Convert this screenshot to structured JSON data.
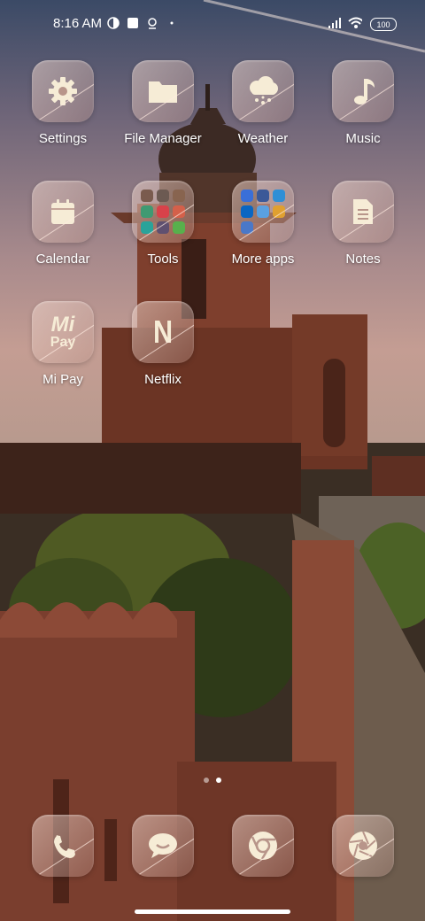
{
  "status_bar": {
    "time": "8:16 AM",
    "battery": "100",
    "icons": [
      "vpn-icon",
      "notification-square-icon",
      "location-pin-icon",
      "dot-icon",
      "signal-icon",
      "wifi-icon",
      "battery-icon"
    ]
  },
  "apps": [
    {
      "label": "Settings",
      "icon": "gear-icon"
    },
    {
      "label": "File Manager",
      "icon": "folder-icon"
    },
    {
      "label": "Weather",
      "icon": "cloud-rain-icon"
    },
    {
      "label": "Music",
      "icon": "music-note-icon"
    },
    {
      "label": "Calendar",
      "icon": "calendar-icon"
    },
    {
      "label": "Tools",
      "icon": "folder-grid-icon"
    },
    {
      "label": "More apps",
      "icon": "folder-grid-icon"
    },
    {
      "label": "Notes",
      "icon": "document-icon"
    },
    {
      "label": "Mi Pay",
      "icon": "mi-pay-icon"
    },
    {
      "label": "Netflix",
      "icon": "netflix-icon"
    }
  ],
  "dock": [
    {
      "name": "phone",
      "icon": "phone-icon"
    },
    {
      "name": "messages",
      "icon": "chat-bubble-icon"
    },
    {
      "name": "browser",
      "icon": "chrome-icon"
    },
    {
      "name": "camera",
      "icon": "aperture-icon"
    }
  ],
  "icon_text": {
    "mi_pay_top": "Mi",
    "mi_pay_bottom": "Pay",
    "netflix": "N"
  },
  "page_indicator": {
    "pages": 2,
    "current": 2
  },
  "colors": {
    "tile_tint": "#e3c9bf",
    "icon_fill": "#f6ecd6"
  }
}
